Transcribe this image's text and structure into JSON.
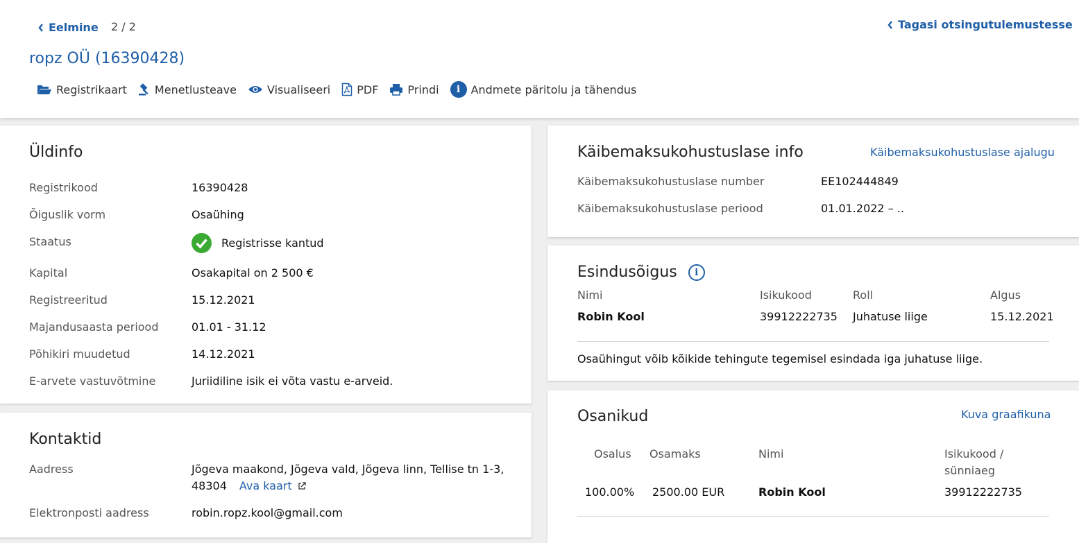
{
  "header": {
    "prev_label": "Eelmine",
    "pager": "2 / 2",
    "back_label": "Tagasi otsingutulemustesse",
    "title": "ropz OÜ (16390428)"
  },
  "toolbar": {
    "items": [
      {
        "label": "Registrikaart",
        "icon": "folder-open-icon"
      },
      {
        "label": "Menetlusteave",
        "icon": "gavel-icon"
      },
      {
        "label": "Visualiseeri",
        "icon": "eye-icon"
      },
      {
        "label": "PDF",
        "icon": "pdf-file-icon"
      },
      {
        "label": "Prindi",
        "icon": "printer-icon"
      },
      {
        "label": "Andmete päritolu ja tähendus",
        "icon": "info-circle-icon"
      }
    ]
  },
  "general": {
    "heading": "Üldinfo",
    "rows": [
      {
        "label": "Registrikood",
        "value": "16390428"
      },
      {
        "label": "Õiguslik vorm",
        "value": "Osaühing"
      },
      {
        "label": "Staatus",
        "value": "Registrisse kantud"
      },
      {
        "label": "Kapital",
        "value": "Osakapital on 2 500 €"
      },
      {
        "label": "Registreeritud",
        "value": "15.12.2021"
      },
      {
        "label": "Majandusaasta periood",
        "value": "01.01 - 31.12"
      },
      {
        "label": "Põhikiri muudetud",
        "value": "14.12.2021"
      },
      {
        "label": "E-arvete vastuvõtmine",
        "value": "Juriidiline isik ei võta vastu e-arveid."
      }
    ]
  },
  "contacts": {
    "heading": "Kontaktid",
    "address_label": "Aadress",
    "address_line1": "Jõgeva maakond, Jõgeva vald, Jõgeva linn, Tellise tn 1-3,",
    "address_line2": "48304",
    "map_link": "Ava kaart",
    "email_label": "Elektronposti aadress",
    "email_value": "robin.ropz.kool@gmail.com"
  },
  "vat": {
    "heading": "Käibemaksukohustuslase info",
    "history_link": "Käibemaksukohustuslase ajalugu",
    "number_label": "Käibemaksukohustuslase number",
    "number_value": "EE102444849",
    "period_label": "Käibemaksukohustuslase periood",
    "period_value": "01.01.2022 – .."
  },
  "representation": {
    "heading": "Esindusõigus",
    "columns": [
      "Nimi",
      "Isikukood",
      "Roll",
      "Algus"
    ],
    "row": [
      "Robin Kool",
      "39912222735",
      "Juhatuse liige",
      "15.12.2021"
    ],
    "note": "Osaühingut võib kõikide tehingute tegemisel esindada iga juhatuse liige."
  },
  "shareholders": {
    "heading": "Osanikud",
    "chart_link": "Kuva graafikuna",
    "columns": [
      "Osalus",
      "Osamaks",
      "Nimi",
      "Isikukood /",
      "sünniaeg"
    ],
    "row": [
      "100.00%",
      "2500.00 EUR",
      "Robin Kool",
      "39912222735"
    ]
  },
  "colors": {
    "link": "#1f5fa8",
    "success": "#3aaa35"
  }
}
